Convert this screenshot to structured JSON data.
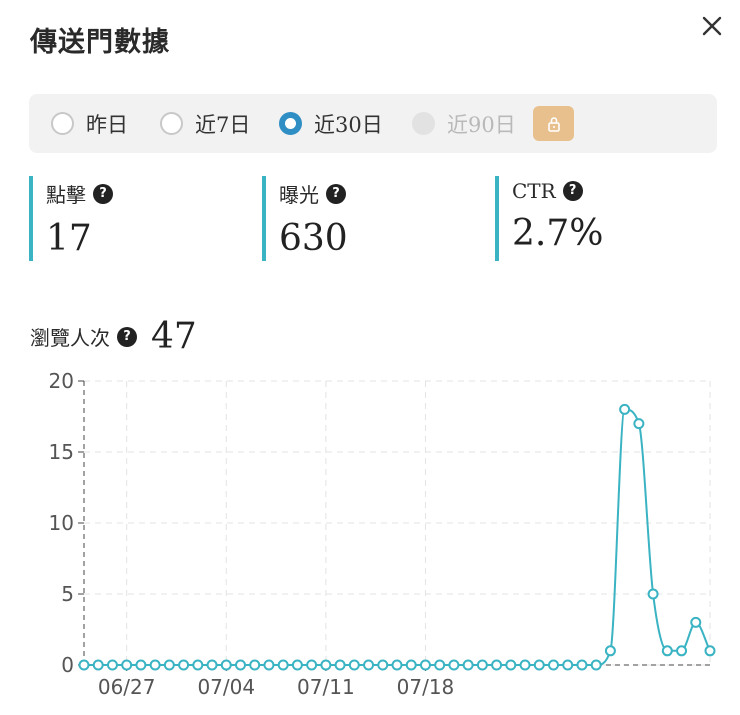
{
  "header": {
    "title": "傳送門數據"
  },
  "range": {
    "options": [
      {
        "label": "昨日",
        "state": "unchecked"
      },
      {
        "label": "近7日",
        "state": "unchecked"
      },
      {
        "label": "近30日",
        "state": "checked"
      },
      {
        "label": "近90日",
        "state": "disabled"
      }
    ]
  },
  "stats": [
    {
      "label": "點擊",
      "value": "17"
    },
    {
      "label": "曝光",
      "value": "630"
    },
    {
      "label": "CTR",
      "value": "2.7%"
    }
  ],
  "views": {
    "label": "瀏覽人次",
    "value": "47"
  },
  "help_glyph": "?",
  "colors": {
    "accent": "#3ab3c3",
    "radio": "#2f8ec4",
    "lock": "#e8c08e"
  },
  "chart_data": {
    "type": "line",
    "x_ticks": [
      "06/27",
      "07/04",
      "07/11",
      "07/18"
    ],
    "y_ticks": [
      "0",
      "5",
      "10",
      "15",
      "20"
    ],
    "ylim": [
      0,
      20
    ],
    "grid": true,
    "series": [
      {
        "values": [
          0,
          0,
          0,
          0,
          0,
          0,
          0,
          0,
          0,
          0,
          0,
          0,
          0,
          0,
          0,
          0,
          0,
          0,
          0,
          0,
          0,
          0,
          0,
          0,
          0,
          0,
          0,
          0,
          0,
          0,
          0,
          0,
          0,
          0,
          0,
          0,
          0,
          1,
          18,
          17,
          5,
          1,
          1,
          3,
          1
        ]
      }
    ]
  }
}
